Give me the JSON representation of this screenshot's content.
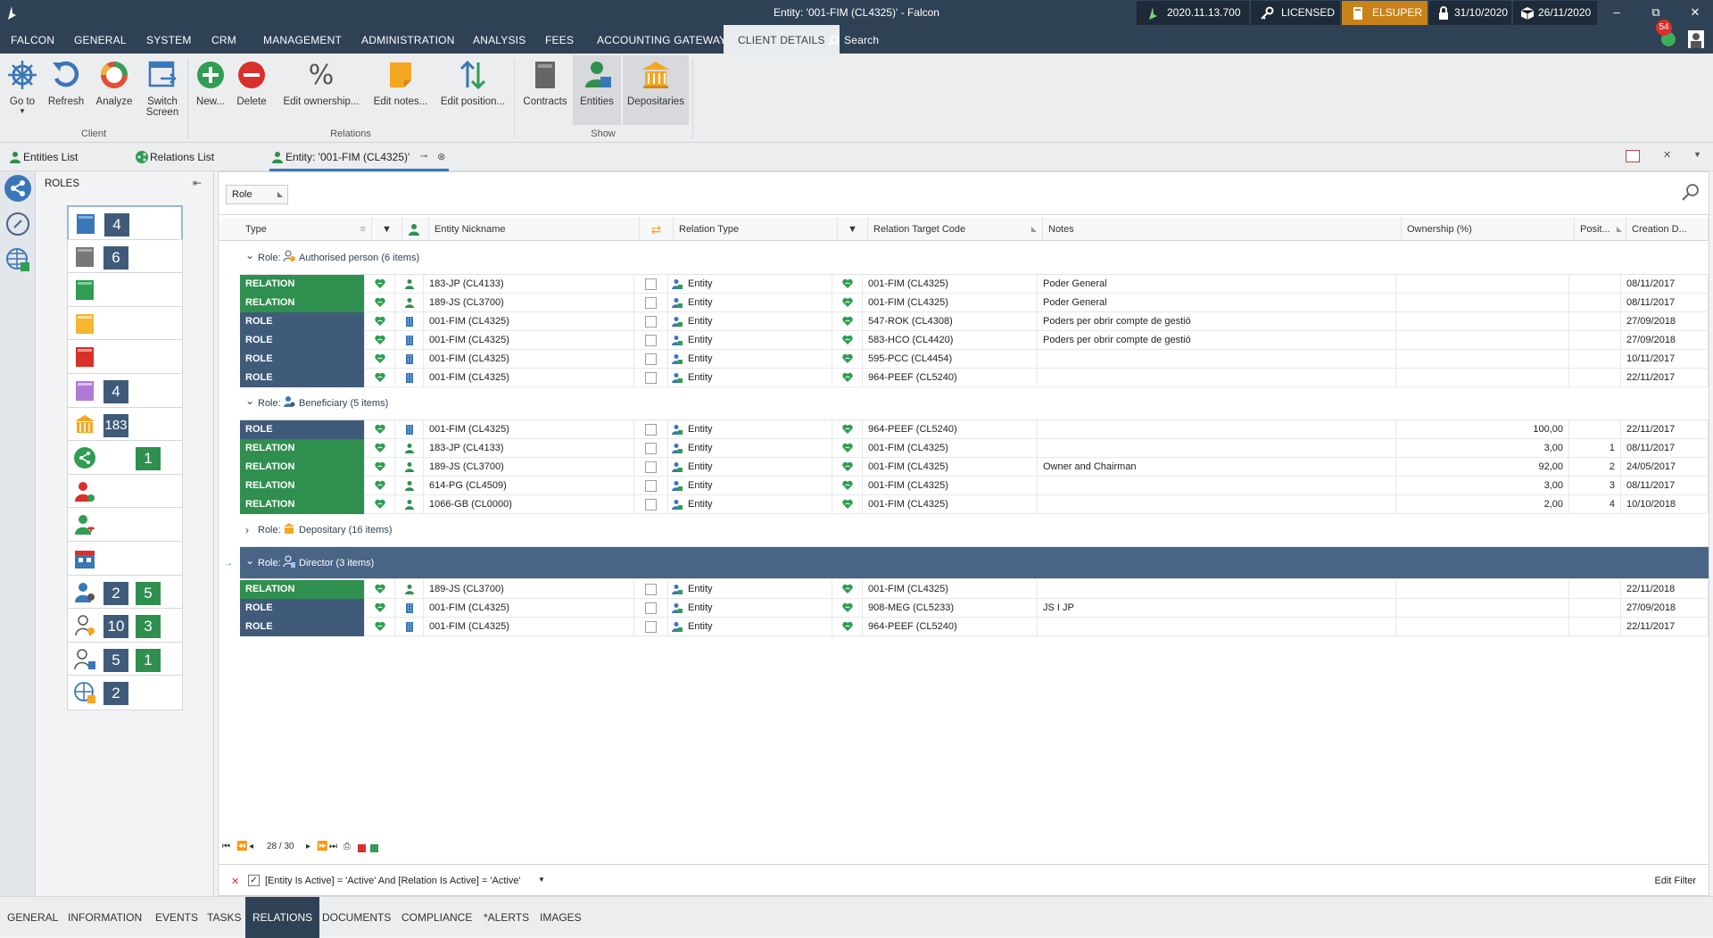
{
  "titlebar": {
    "title": "Entity: '001-FIM  (CL4325)' - Falcon",
    "version": "2020.11.13.700",
    "license": "LICENSED",
    "user": "ELSUPER",
    "lock_date": "31/10/2020",
    "cube_date": "26/11/2020",
    "notifications": "54"
  },
  "menu": [
    "FALCON",
    "GENERAL",
    "SYSTEM",
    "CRM",
    "MANAGEMENT",
    "ADMINISTRATION",
    "ANALYSIS",
    "FEES",
    "ACCOUNTING GATEWAY",
    "CLIENT DETAILS"
  ],
  "menu_search": "Search",
  "ribbon": {
    "goto": "Go to",
    "refresh": "Refresh",
    "analyze": "Analyze",
    "switch1": "Switch",
    "switch2": "Screen",
    "new": "New...",
    "delete": "Delete",
    "edit_ownership": "Edit ownership...",
    "edit_notes": "Edit notes...",
    "edit_position": "Edit position...",
    "contracts": "Contracts",
    "entities": "Entities",
    "depositaries": "Depositaries",
    "group_client": "Client",
    "group_relations": "Relations",
    "group_show": "Show"
  },
  "doc_tabs": [
    "Entities List",
    "Relations List",
    "Entity: '001-FIM  (CL4325)'"
  ],
  "roles_panel": {
    "title": "ROLES",
    "cards": [
      {
        "n1": "4",
        "n2": ""
      },
      {
        "n1": "6",
        "n2": ""
      },
      {
        "n1": "",
        "n2": ""
      },
      {
        "n1": "",
        "n2": ""
      },
      {
        "n1": "",
        "n2": ""
      },
      {
        "n1": "4",
        "n2": ""
      },
      {
        "n1": "183",
        "n2": ""
      },
      {
        "n1": "",
        "n2": "1"
      },
      {
        "n1": "",
        "n2": ""
      },
      {
        "n1": "",
        "n2": ""
      },
      {
        "n1": "",
        "n2": ""
      },
      {
        "n1": "2",
        "n2": "5"
      },
      {
        "n1": "10",
        "n2": "3"
      },
      {
        "n1": "5",
        "n2": "1"
      },
      {
        "n1": "2",
        "n2": ""
      }
    ]
  },
  "grid": {
    "group_chip": "Role",
    "headers": {
      "type": "Type",
      "nickname": "Entity Nickname",
      "relation_type": "Relation Type",
      "target": "Relation Target Code",
      "notes": "Notes",
      "ownership": "Ownership (%)",
      "position": "Posit...",
      "creation": "Creation D..."
    },
    "groups": [
      {
        "label": "Role:",
        "name": "Authorised person (6 items)",
        "expanded": true,
        "rows": [
          {
            "type": "RELATION",
            "nick": "183-JP  (CL4133)",
            "rtype": "Entity",
            "target": "001-FIM  (CL4325)",
            "notes": "Poder General",
            "own": "",
            "pos": "",
            "date": "08/11/2017"
          },
          {
            "type": "RELATION",
            "nick": "189-JS  (CL3700)",
            "rtype": "Entity",
            "target": "001-FIM  (CL4325)",
            "notes": "Poder General",
            "own": "",
            "pos": "",
            "date": "08/11/2017"
          },
          {
            "type": "ROLE",
            "nick": "001-FIM  (CL4325)",
            "rtype": "Entity",
            "target": "547-ROK  (CL4308)",
            "notes": "Poders per obrir compte de gestió",
            "own": "",
            "pos": "",
            "date": "27/09/2018"
          },
          {
            "type": "ROLE",
            "nick": "001-FIM  (CL4325)",
            "rtype": "Entity",
            "target": "583-HCO  (CL4420)",
            "notes": "Poders per obrir compte de gestió",
            "own": "",
            "pos": "",
            "date": "27/09/2018"
          },
          {
            "type": "ROLE",
            "nick": "001-FIM  (CL4325)",
            "rtype": "Entity",
            "target": "595-PCC  (CL4454)",
            "notes": "",
            "own": "",
            "pos": "",
            "date": "10/11/2017"
          },
          {
            "type": "ROLE",
            "nick": "001-FIM  (CL4325)",
            "rtype": "Entity",
            "target": "964-PEEF  (CL5240)",
            "notes": "",
            "own": "",
            "pos": "",
            "date": "22/11/2017"
          }
        ]
      },
      {
        "label": "Role:",
        "name": "Beneficiary (5 items)",
        "expanded": true,
        "rows": [
          {
            "type": "ROLE",
            "nick": "001-FIM  (CL4325)",
            "rtype": "Entity",
            "target": "964-PEEF  (CL5240)",
            "notes": "",
            "own": "100,00",
            "pos": "",
            "date": "22/11/2017"
          },
          {
            "type": "RELATION",
            "nick": "183-JP  (CL4133)",
            "rtype": "Entity",
            "target": "001-FIM  (CL4325)",
            "notes": "",
            "own": "3,00",
            "pos": "1",
            "date": "08/11/2017"
          },
          {
            "type": "RELATION",
            "nick": "189-JS  (CL3700)",
            "rtype": "Entity",
            "target": "001-FIM  (CL4325)",
            "notes": "Owner and Chairman",
            "own": "92,00",
            "pos": "2",
            "date": "24/05/2017"
          },
          {
            "type": "RELATION",
            "nick": "614-PG  (CL4509)",
            "rtype": "Entity",
            "target": "001-FIM  (CL4325)",
            "notes": "",
            "own": "3,00",
            "pos": "3",
            "date": "08/11/2017"
          },
          {
            "type": "RELATION",
            "nick": "1066-GB (CL0000)",
            "rtype": "Entity",
            "target": "001-FIM  (CL4325)",
            "notes": "",
            "own": "2,00",
            "pos": "4",
            "date": "10/10/2018"
          }
        ]
      },
      {
        "label": "Role:",
        "name": "Depositary (16 items)",
        "expanded": false,
        "rows": []
      },
      {
        "label": "Role:",
        "name": "Director (3 items)",
        "expanded": true,
        "rows": [
          {
            "type": "RELATION",
            "nick": "189-JS  (CL3700)",
            "rtype": "Entity",
            "target": "001-FIM  (CL4325)",
            "notes": "",
            "own": "",
            "pos": "",
            "date": "22/11/2018"
          },
          {
            "type": "ROLE",
            "nick": "001-FIM  (CL4325)",
            "rtype": "Entity",
            "target": "908-MEG  (CL5233)",
            "notes": "JS I JP",
            "own": "",
            "pos": "",
            "date": "27/09/2018"
          },
          {
            "type": "ROLE",
            "nick": "001-FIM  (CL4325)",
            "rtype": "Entity",
            "target": "964-PEEF  (CL5240)",
            "notes": "",
            "own": "",
            "pos": "",
            "date": "22/11/2017"
          }
        ]
      }
    ],
    "pager": "28 / 30",
    "filter": "[Entity Is Active] = 'Active' And [Relation Is Active] = 'Active'",
    "edit_filter": "Edit Filter"
  },
  "bottom_tabs": [
    "GENERAL",
    "INFORMATION",
    "EVENTS",
    "TASKS",
    "RELATIONS",
    "DOCUMENTS",
    "COMPLIANCE",
    "*ALERTS",
    "IMAGES"
  ],
  "colors": {
    "titlebar": "#2f4155",
    "relation": "#2f8f4e",
    "role": "#3f5b79",
    "selected_group": "#4a6486",
    "licensed_user": "#c9821a"
  }
}
